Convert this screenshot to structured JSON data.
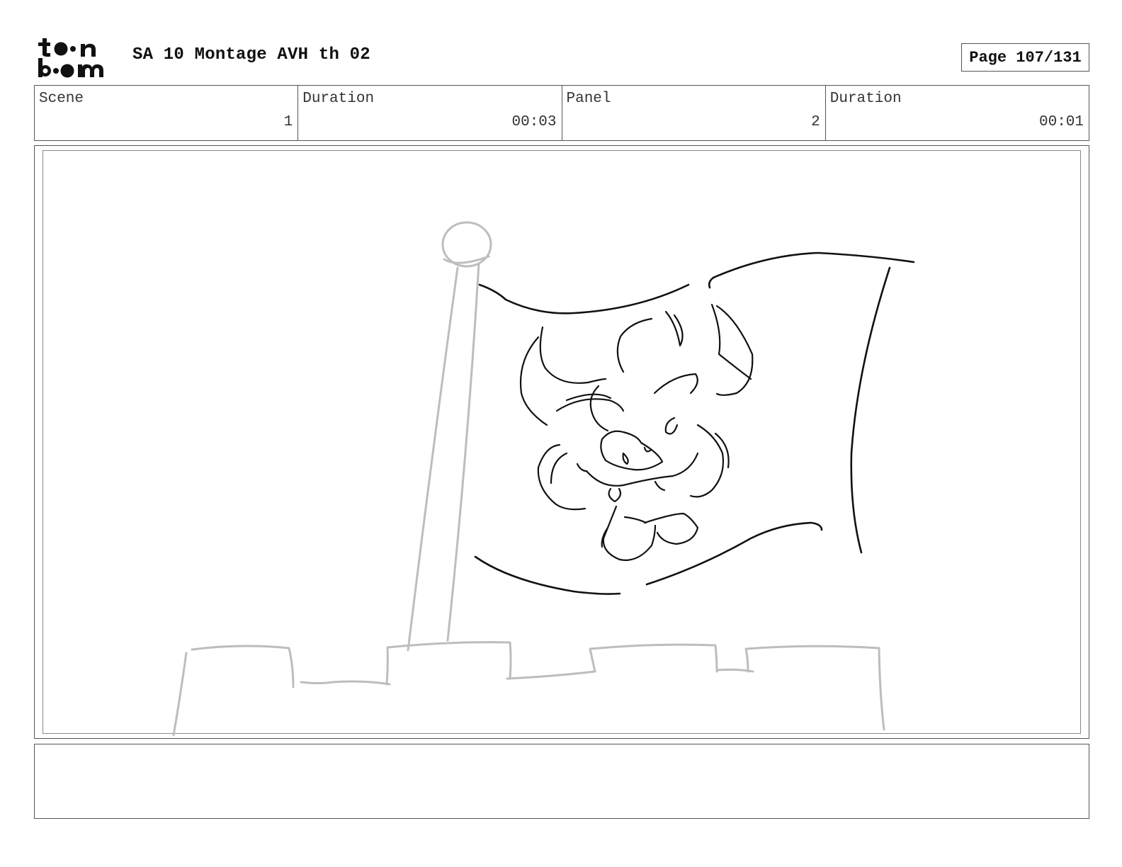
{
  "header": {
    "logo_text_top": "toon",
    "logo_text_bottom": "boom",
    "title": "SA 10 Montage AVH th 02",
    "page_label": "Page 107/131"
  },
  "info": {
    "scene_label": "Scene",
    "scene_value": "1",
    "scene_duration_label": "Duration",
    "scene_duration_value": "00:03",
    "panel_label": "Panel",
    "panel_value": "2",
    "panel_duration_label": "Duration",
    "panel_duration_value": "00:01"
  },
  "panel": {
    "image": "storyboard-sketch-flag-on-castle"
  },
  "notes": {
    "text": ""
  }
}
